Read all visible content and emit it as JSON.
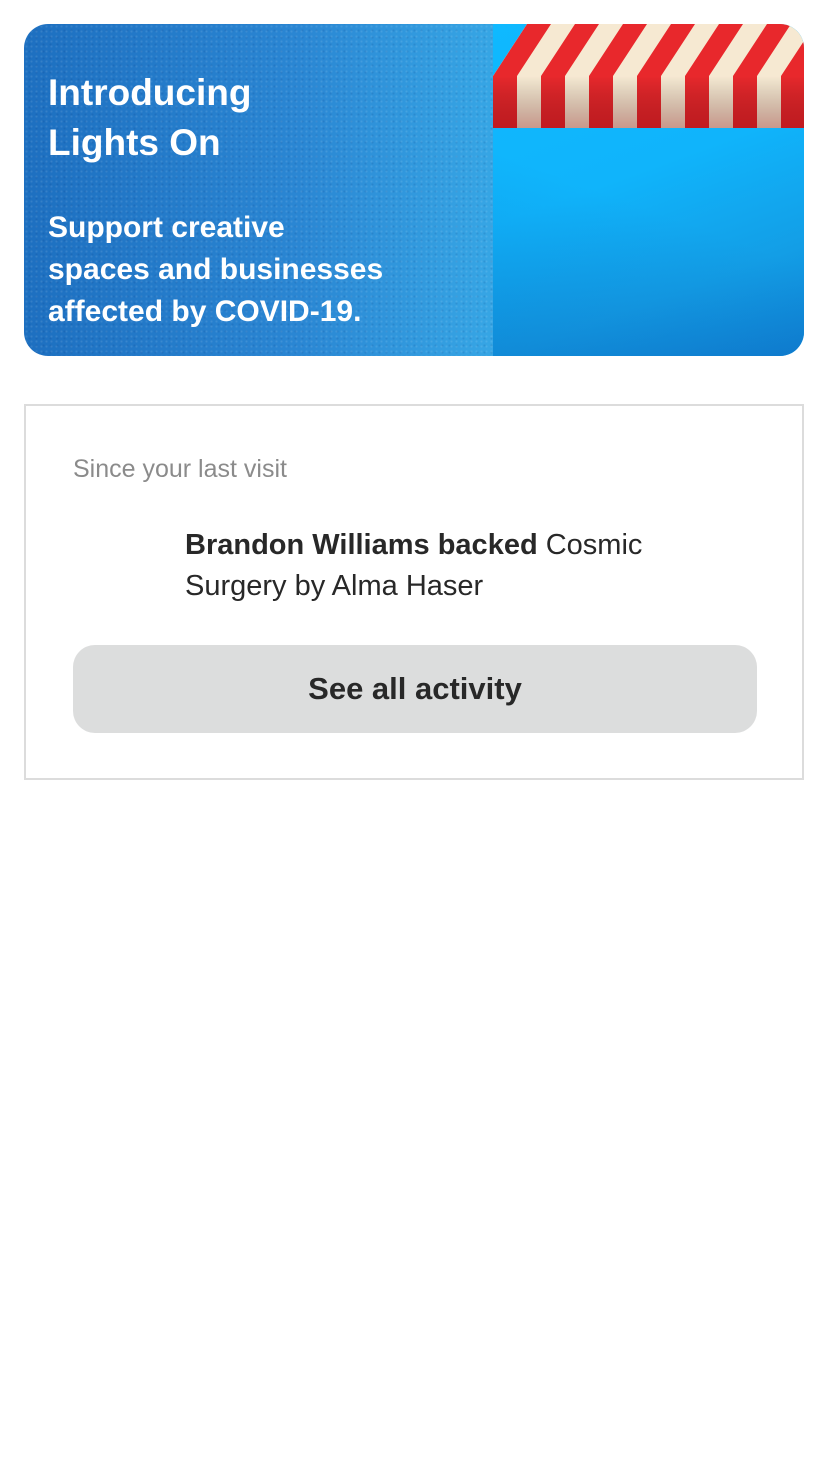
{
  "banner": {
    "title": "Introducing\nLights On",
    "subtitle": "Support creative\nspaces and businesses\naffected by COVID-19.",
    "illustration": "storefront-awning-icon",
    "colors": {
      "gradient_start": "#1d6fc0",
      "gradient_end": "#19b6f7",
      "awning_red": "#e8282c",
      "awning_cream": "#f6e9d2"
    }
  },
  "activity": {
    "section_label": "Since your last visit",
    "items": [
      {
        "actor": "Brandon Williams backed",
        "object": "Cosmic Surgery by Alma Haser"
      }
    ],
    "see_all_label": "See all activity",
    "colors": {
      "button_bg": "#dcdddd",
      "border": "#dcdcdc"
    }
  }
}
